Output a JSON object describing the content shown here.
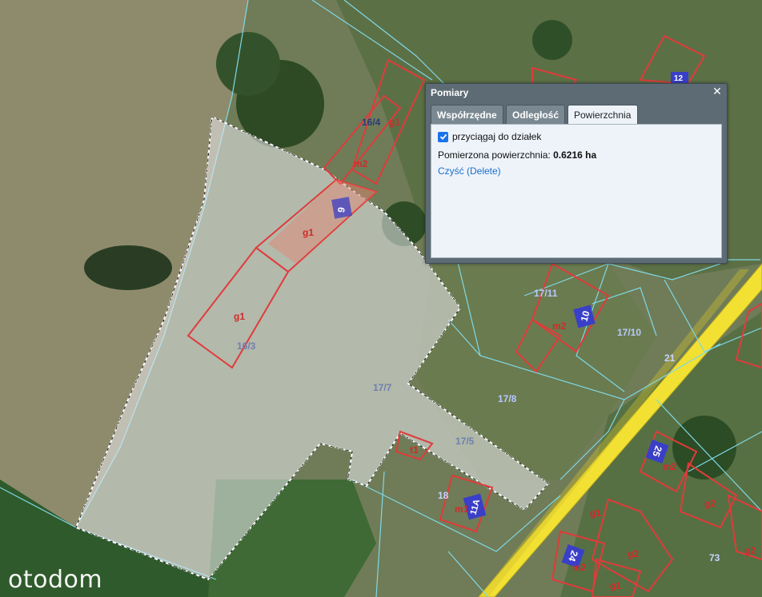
{
  "panel": {
    "title": "Pomiary",
    "close_icon": "close-icon",
    "tabs": [
      {
        "label": "Współrzędne",
        "active": false
      },
      {
        "label": "Odległość",
        "active": false
      },
      {
        "label": "Powierzchnia",
        "active": true
      }
    ],
    "snap_label": "przyciągaj do działek",
    "snap_checked": true,
    "area_label": "Pomierzona powierzchnia:",
    "area_value": "0.6216 ha",
    "clear_link": "Czyść (Delete)"
  },
  "parcels": {
    "p16_4": "16/4",
    "p16_3": "16/3",
    "p17_7": "17/7",
    "p17_8": "17/8",
    "p17_5": "17/5",
    "p17_11": "17/11",
    "p17_10": "17/10",
    "p18": "18",
    "p21": "21",
    "p73": "73"
  },
  "buildings": {
    "b_g1_top": "g1",
    "b_m2_top": "m2",
    "b_g1_mid": "g1",
    "b_g1_left": "g1",
    "b_m2_17_11": "m2",
    "b_t1": "t1",
    "b_m1": "m1",
    "b_m2_25": "m2",
    "b_g1_lr": "g1",
    "b_g2_lr": "g2",
    "b_g2_r": "g2",
    "b_g2_rr": "g2",
    "b_m2_24": "m2",
    "b_g1_bot": "g1"
  },
  "house_numbers": {
    "n9": "9",
    "n10": "10",
    "n11a": "11A",
    "n25": "25",
    "n24": "24",
    "n12": "12"
  },
  "watermark": "otodom",
  "colors": {
    "parcel_line": "#7fd8e6",
    "building_line": "#e03b3b",
    "road": "#f2e033",
    "number_badge": "#3a3fc7",
    "measure_fill": "rgba(235,235,240,0.55)"
  }
}
